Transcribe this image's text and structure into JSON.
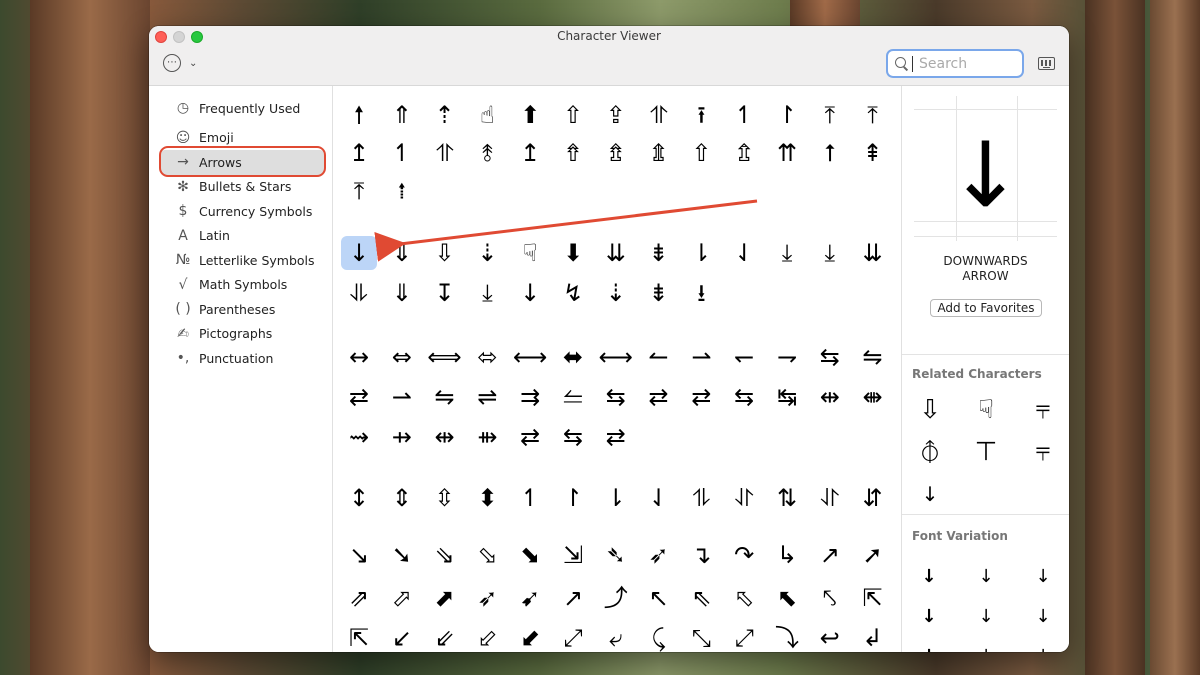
{
  "window": {
    "title": "Character Viewer"
  },
  "search": {
    "placeholder": "Search"
  },
  "sidebar": {
    "items": [
      {
        "label": "Frequently Used",
        "icon": "◷",
        "icon_name": "clock-icon"
      },
      {
        "label": "Emoji",
        "icon": "☺",
        "icon_name": "smiley-icon"
      },
      {
        "label": "Arrows",
        "icon": "→",
        "icon_name": "arrow-icon",
        "selected": true
      },
      {
        "label": "Bullets & Stars",
        "icon": "✻",
        "icon_name": "asterisk-icon"
      },
      {
        "label": "Currency Symbols",
        "icon": "$",
        "icon_name": "dollar-icon"
      },
      {
        "label": "Latin",
        "icon": "A",
        "icon_name": "latin-a-icon"
      },
      {
        "label": "Letterlike Symbols",
        "icon": "№",
        "icon_name": "numero-icon"
      },
      {
        "label": "Math Symbols",
        "icon": "√",
        "icon_name": "square-root-icon"
      },
      {
        "label": "Parentheses",
        "icon": "( )",
        "icon_name": "parentheses-icon"
      },
      {
        "label": "Pictographs",
        "icon": "✍",
        "icon_name": "pictograph-icon"
      },
      {
        "label": "Punctuation",
        "icon": "•,",
        "icon_name": "punctuation-icon"
      }
    ]
  },
  "grid": {
    "rows": [
      [
        "🠕",
        "⇑",
        "⇡",
        "☝",
        "⬆",
        "⇧",
        "⇪",
        "⥣",
        "⭱",
        "↿",
        "↾",
        "⤒",
        "⤒"
      ],
      [
        "↥",
        "↿",
        "⥣",
        "⥉",
        "↥",
        "⇮",
        "⇯",
        "⇭",
        "⇧",
        "⇬",
        "⇈",
        "⭡",
        "⇞"
      ],
      [
        "⤒",
        "⭫"
      ],
      [],
      [
        "↓",
        "⇓",
        "⇩",
        "⇣",
        "☟",
        "⬇",
        "⇊",
        "⇟",
        "⇂",
        "⇃",
        "⤓",
        "⤓",
        "⇊"
      ],
      [
        "⥥",
        "⇓",
        "↧",
        "⤓",
        "↓",
        "↯",
        "⇣",
        "⇟",
        "⭳"
      ],
      [],
      [
        "↔",
        "⇔",
        "⟺",
        "⬄",
        "⟷",
        "⬌",
        "⟷",
        "↼",
        "⇀",
        "↽",
        "⇁",
        "⇆",
        "⇋"
      ],
      [
        "⇄",
        "⇀",
        "⇋",
        "⇌",
        "⇉",
        "⥪",
        "⇆",
        "⇄",
        "⇄",
        "⇆",
        "↹",
        "⇹",
        "⇼"
      ],
      [
        "⇝",
        "⇸",
        "⇹",
        "⇻",
        "⇄",
        "⇆",
        "⇄"
      ],
      [],
      [
        "↕",
        "⇕",
        "⇳",
        "⬍",
        "↿",
        "↾",
        "⇂",
        "⇃",
        "⥮",
        "⥯",
        "⇅",
        "⥯",
        "⇵"
      ],
      [],
      [
        "↘",
        "➘",
        "⇘",
        "⬂",
        "⬊",
        "⇲",
        "➴",
        "➶",
        "↴",
        "↷",
        "↳",
        "↗",
        "➚"
      ],
      [
        "⇗",
        "⬀",
        "⬈",
        "➶",
        "➹",
        "↗",
        "⤴",
        "↖",
        "⇖",
        "⬁",
        "⬉",
        "⤣",
        "⇱"
      ],
      [
        "⇱",
        "↙",
        "⇙",
        "⬃",
        "⬋",
        "⤢",
        "⤶",
        "⤹",
        "⤡",
        "⤢",
        "⤵",
        "↩",
        "↲"
      ]
    ]
  },
  "detail": {
    "preview_char": "↓",
    "name_line1": "DOWNWARDS",
    "name_line2": "ARROW",
    "favorites_label": "Add to Favorites",
    "related_title": "Related Characters",
    "related": [
      "⇩",
      "☟",
      "⫧",
      "⦽",
      "⊤",
      "⫧",
      "↓"
    ],
    "font_variation_title": "Font Variation",
    "font_variations": [
      "↓",
      "↓",
      "↓",
      "↓",
      "↓",
      "↓",
      "↓",
      "↓",
      "↓"
    ]
  },
  "annotation": {
    "color": "#e04a33"
  }
}
